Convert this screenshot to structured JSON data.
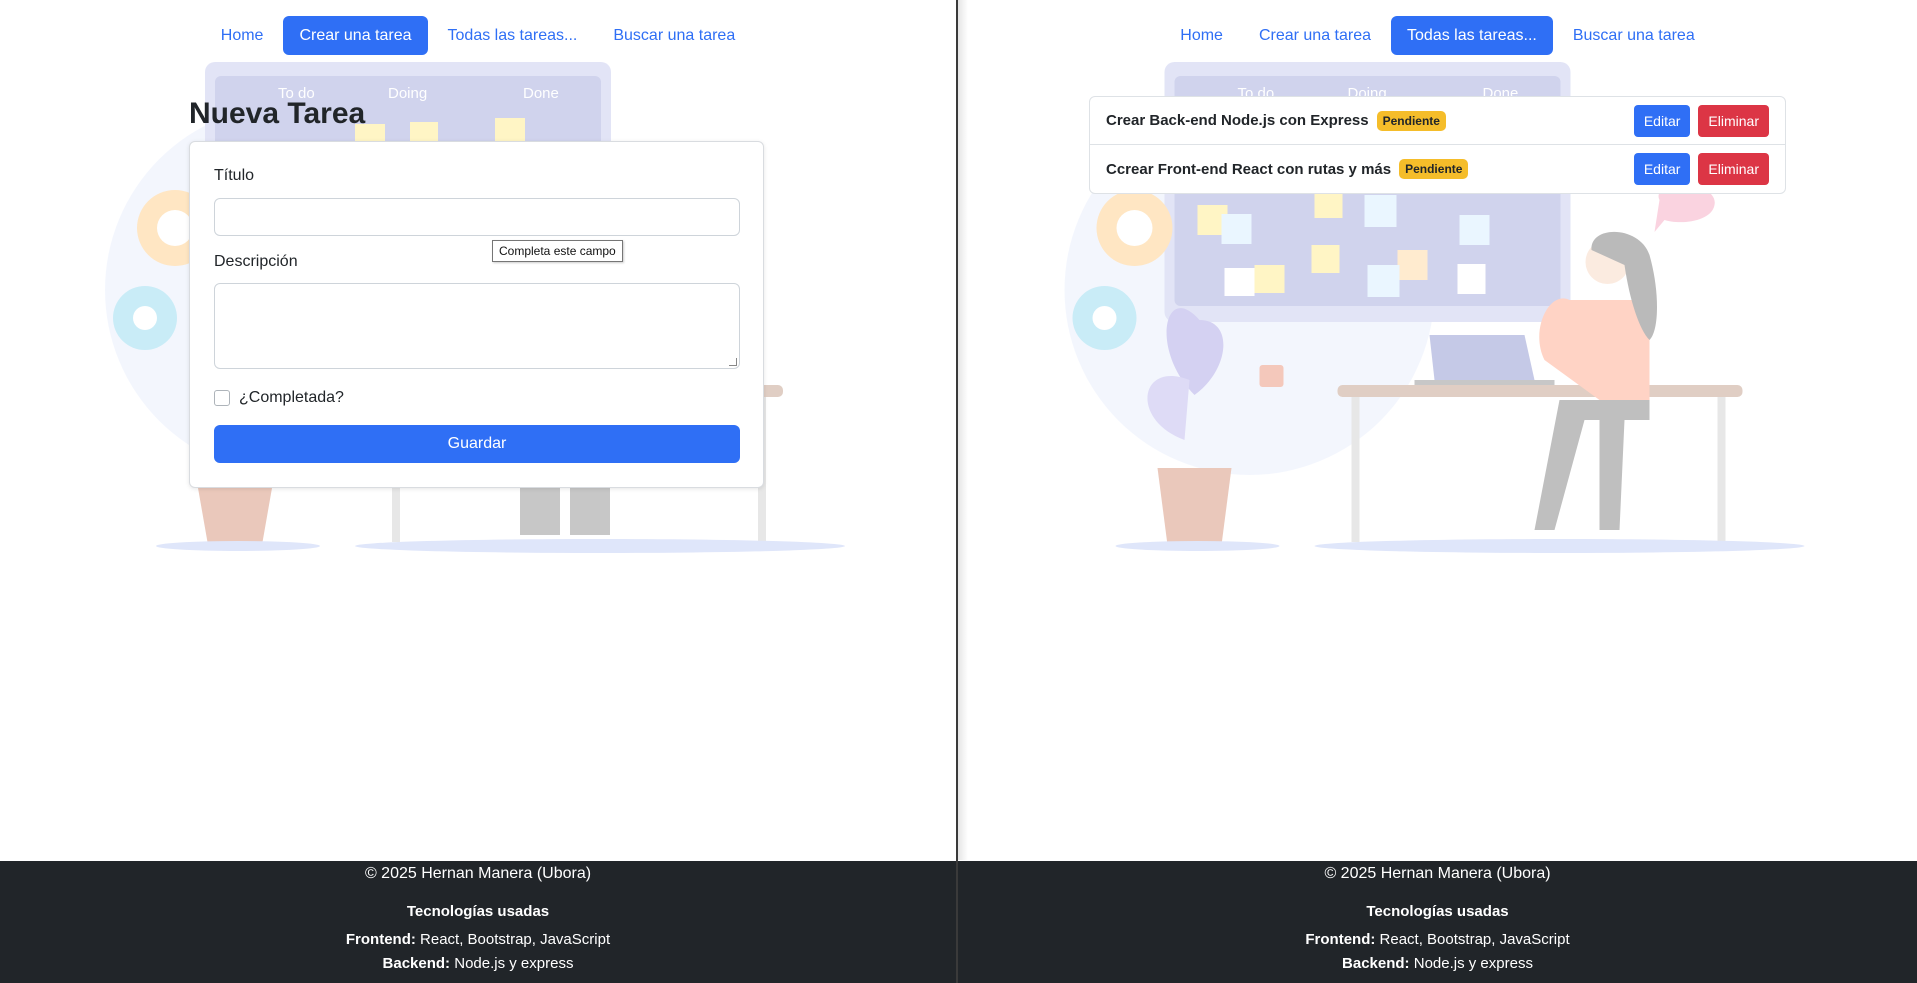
{
  "nav": {
    "home": "Home",
    "create": "Crear una tarea",
    "all": "Todas las tareas...",
    "search": "Buscar una tarea"
  },
  "illustration": {
    "col_todo": "To do",
    "col_doing": "Doing",
    "col_done": "Done"
  },
  "form": {
    "heading": "Nueva Tarea",
    "title_label": "Título",
    "title_value": "",
    "description_label": "Descripción",
    "description_value": "",
    "completed_label": "¿Completada?",
    "completed_checked": false,
    "save_button": "Guardar",
    "validation_tooltip": "Completa este campo"
  },
  "tasks": [
    {
      "title": "Crear Back-end Node.js con Express",
      "status": "Pendiente",
      "edit": "Editar",
      "delete": "Eliminar"
    },
    {
      "title": "Ccrear Front-end React con rutas y más",
      "status": "Pendiente",
      "edit": "Editar",
      "delete": "Eliminar"
    }
  ],
  "footer": {
    "copyright": "© 2025 Hernan Manera (Ubora)",
    "tech_heading": "Tecnologías usadas",
    "frontend_label": "Frontend:",
    "frontend_value": " React, Bootstrap, JavaScript",
    "backend_label": "Backend:",
    "backend_value": " Node.js y express"
  },
  "colors": {
    "primary": "#2f6ff5",
    "danger": "#dc3545",
    "warning": "#f5bd2a",
    "footer_bg": "#212529"
  }
}
